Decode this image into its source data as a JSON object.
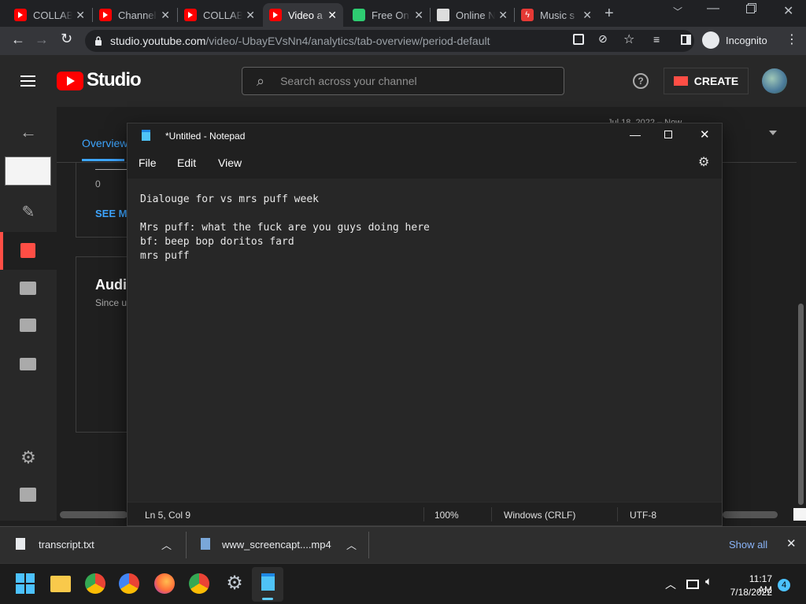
{
  "browser": {
    "tabs": [
      {
        "title": "COLLAB",
        "favicon": "youtube-icon",
        "active": false
      },
      {
        "title": "Channel",
        "favicon": "youtube-icon",
        "active": false
      },
      {
        "title": "COLLAB",
        "favicon": "youtube-icon",
        "active": false
      },
      {
        "title": "Video a",
        "favicon": "youtube-icon",
        "active": false
      },
      {
        "title": "Free On",
        "favicon": "green-app-icon",
        "active": true
      },
      {
        "title": "Online N",
        "favicon": "notepad-icon",
        "active": false
      },
      {
        "title": "Music s",
        "favicon": "bolt-icon",
        "active": false
      }
    ],
    "url_host": "studio.youtube.com",
    "url_path": "/video/-UbayEVsNn4/analytics/tab-overview/period-default",
    "profile_label": "Incognito"
  },
  "studio": {
    "logo_text": "Studio",
    "search_placeholder": "Search across your channel",
    "create_label": "CREATE",
    "tab_overview": "Overview",
    "date_text": "Jul 18, 2022 – Now",
    "axis_zero": "0",
    "see_more": "SEE M",
    "card_title": "Audie",
    "card_subtitle": "Since u"
  },
  "notepad": {
    "window_title": "*Untitled - Notepad",
    "menu": [
      "File",
      "Edit",
      "View"
    ],
    "lines": [
      "Dialouge for vs mrs puff week",
      "",
      "Mrs puff: what the fuck are you guys doing here",
      "bf: beep bop doritos fard",
      "mrs puff"
    ],
    "status": {
      "position": "Ln 5, Col 9",
      "zoom": "100%",
      "line_ending": "Windows (CRLF)",
      "encoding": "UTF-8"
    }
  },
  "downloads": {
    "items": [
      {
        "name": "transcript.txt"
      },
      {
        "name": "www_screencapt....mp4"
      }
    ],
    "show_all": "Show all"
  },
  "taskbar": {
    "time": "11:17 AM",
    "date": "7/18/2022",
    "notification_count": "4"
  },
  "colors": {
    "youtube_red": "#ff0000",
    "accent_blue": "#3ea6ff",
    "studio_active": "#ff4e45"
  }
}
